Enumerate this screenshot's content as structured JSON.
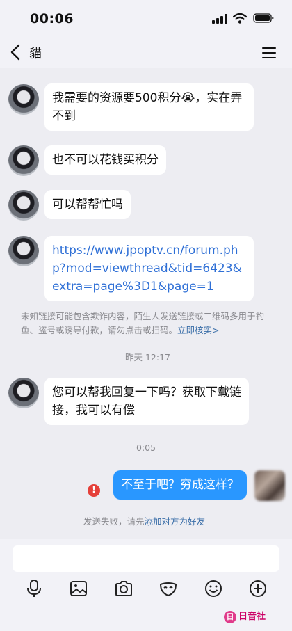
{
  "status_bar": {
    "time": "00:06"
  },
  "header": {
    "title": "貓"
  },
  "messages": [
    {
      "text": "我需要的资源要500积分😭，实在弄不到"
    },
    {
      "text": "也不可以花钱买积分"
    },
    {
      "text": "可以帮帮忙吗"
    },
    {
      "link": "https://www.jpoptv.cn/forum.php?mod=viewthread&tid=6423&extra=page%3D1&page=1"
    }
  ],
  "warning": {
    "text": "未知链接可能包含欺诈内容，陌生人发送链接或二维码多用于钓鱼、盗号或诱导付款，请勿点击或扫码。",
    "action": "立即核实>"
  },
  "timestamps": {
    "t1": "昨天 12:17",
    "t2": "0:05"
  },
  "message_after_gap": "您可以帮我回复一下吗？获取下载链接，我可以有偿",
  "outgoing": {
    "text": "不至于吧？穷成这样？",
    "error_mark": "!"
  },
  "send_failed": {
    "text": "发送失败，请先",
    "action": "添加对方为好友"
  },
  "toolbar_icons": [
    "microphone-icon",
    "image-icon",
    "camera-icon",
    "mask-icon",
    "emoji-icon",
    "plus-icon"
  ],
  "watermark": {
    "logo": "日",
    "text": "日音社"
  }
}
